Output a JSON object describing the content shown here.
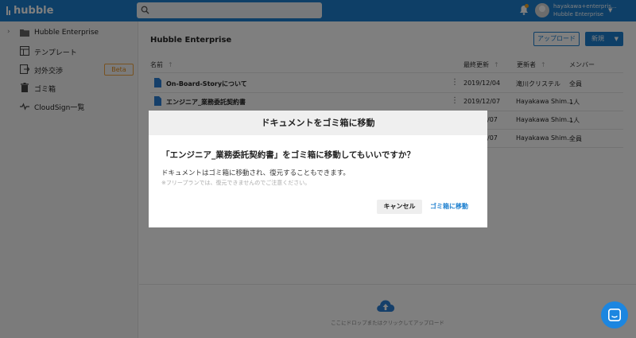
{
  "header": {
    "logo": "hubble",
    "search_placeholder": "",
    "user_email": "hayakawa+enterpris...",
    "user_org": "Hubble Enterprise"
  },
  "sidebar": {
    "items": [
      {
        "label": "Hubble Enterprise",
        "icon": "folder-icon"
      },
      {
        "label": "テンプレート",
        "icon": "template-icon"
      },
      {
        "label": "対外交渉",
        "icon": "external-negotiation-icon",
        "badge": "Beta"
      },
      {
        "label": "ゴミ箱",
        "icon": "trash-icon"
      },
      {
        "label": "CloudSign一覧",
        "icon": "cloudsign-icon"
      }
    ]
  },
  "main": {
    "title": "Hubble Enterprise",
    "upload_label": "アップロード",
    "new_label": "新規",
    "columns": {
      "name": "名前",
      "updated": "最終更新",
      "updater": "更新者",
      "members": "メンバー"
    },
    "rows": [
      {
        "name": "On-Board-Storyについて",
        "date": "2019/12/04",
        "updater": "滝川クリステル",
        "members": "全員"
      },
      {
        "name": "エンジニア_業務委託契約書",
        "date": "2019/12/07",
        "updater": "Hayakawa Shim...",
        "members": "1人"
      },
      {
        "name": "",
        "date": "/07",
        "updater": "Hayakawa Shim...",
        "members": "1人"
      },
      {
        "name": "",
        "date": "/07",
        "updater": "Hayakawa Shim...",
        "members": "全員"
      }
    ],
    "dropzone_text": "ここにドロップまたはクリックしてアップロード"
  },
  "dialog": {
    "title": "ドキュメントをゴミ箱に移動",
    "question": "「エンジニア_業務委託契約書」をゴミ箱に移動してもいいですか？",
    "body": "ドキュメントはゴミ箱に移動され、復元することもできます。",
    "note": "※フリープランでは、復元できませんのでご注意ください。",
    "cancel_label": "キャンセル",
    "confirm_label": "ゴミ箱に移動"
  },
  "colors": {
    "brand": "#1c7fcf",
    "beta": "#f0a440",
    "overlay": "rgba(0,0,0,0.5)"
  }
}
